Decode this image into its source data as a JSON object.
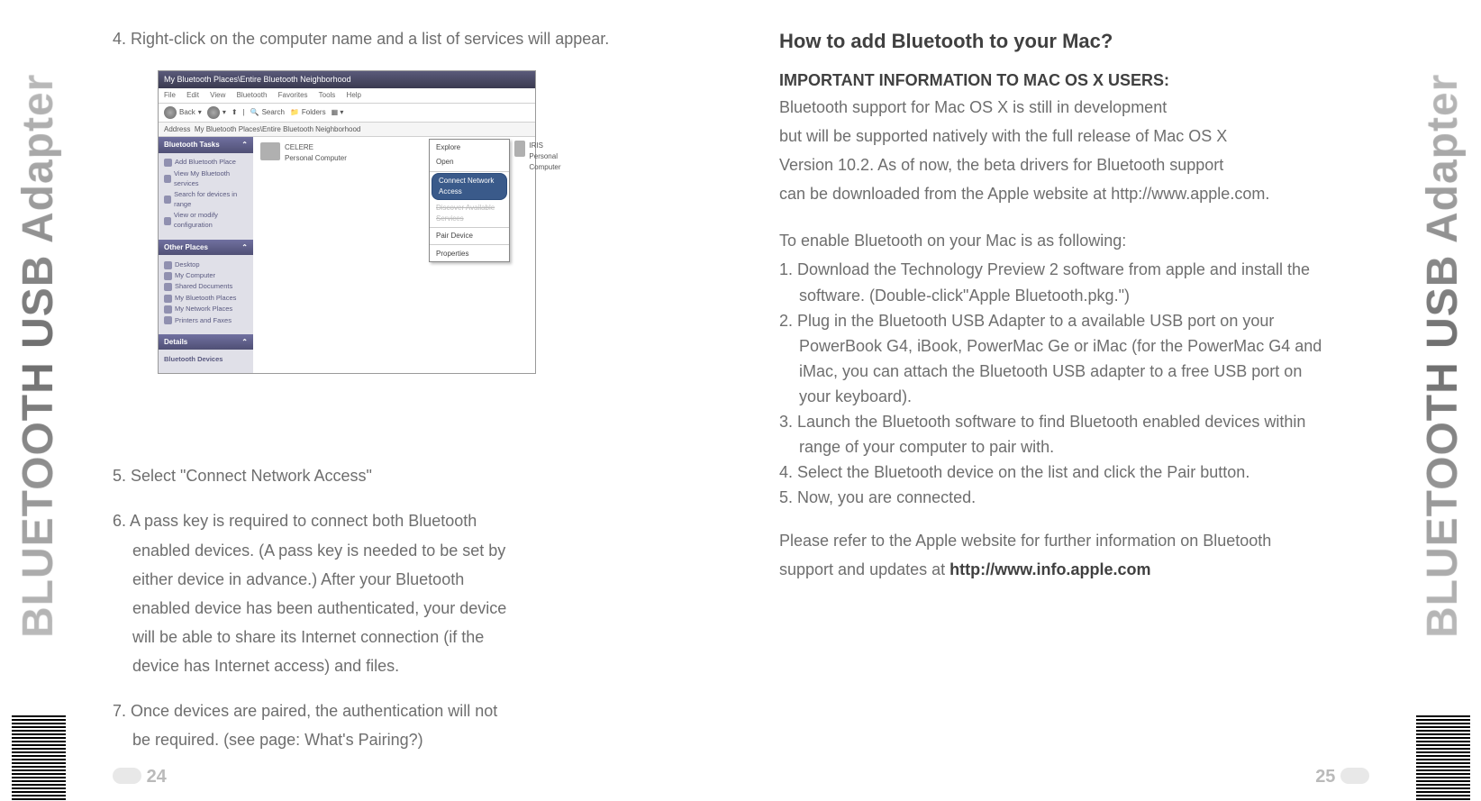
{
  "side_label": "BLUETOOTH USB Adapter",
  "left_page": {
    "step4": "4.  Right-click on the computer name and a list of services will appear.",
    "step5": "5. Select \"Connect Network Access\"",
    "step6_lead": "6. A pass key is required to connect both Bluetooth",
    "step6_l2": "enabled devices.  (A pass key is needed to be set by",
    "step6_l3": "either device in advance.) After your Bluetooth",
    "step6_l4": "enabled device has been authenticated, your device",
    "step6_l5": "will be able to share its Internet connection (if the",
    "step6_l6": "device has Internet access) and files.",
    "step7_lead": "7.  Once devices are paired, the authentication will not",
    "step7_l2": "be required. (see page: What's Pairing?)",
    "page_number": "24"
  },
  "right_page": {
    "heading": "How to add Bluetooth to your Mac?",
    "important": "IMPORTANT INFORMATION TO MAC OS X USERS:",
    "p1_l1": "Bluetooth support for Mac OS X is still in development",
    "p1_l2": "but will be supported natively with the full release of Mac OS X",
    "p1_l3": "Version 10.2.  As of now, the beta drivers for Bluetooth support",
    "p1_l4": "can be downloaded from the Apple website at http://www.apple.com.",
    "p2": "To enable Bluetooth on your Mac is as following:",
    "li1_l1": "1. Download the Technology Preview 2 software from apple and install the",
    "li1_l2": "software. (Double-click\"Apple Bluetooth.pkg.\")",
    "li2_l1": "2. Plug in the Bluetooth USB Adapter to a available USB port on your",
    "li2_l2": "PowerBook G4, iBook, PowerMac Ge or iMac (for the PowerMac G4 and",
    "li2_l3": "iMac, you can attach the Bluetooth USB adapter to a free USB port on",
    "li2_l4": "your keyboard).",
    "li3_l1": "3. Launch the Bluetooth software to find Bluetooth enabled devices within",
    "li3_l2": "range of your computer to pair with.",
    "li4": "4. Select the Bluetooth device on the list and click the Pair button.",
    "li5": "5. Now, you are connected.",
    "p3_l1": "Please refer to the Apple website for further information on Bluetooth",
    "p3_l2_a": "support and updates at ",
    "p3_l2_b": "http://www.info.apple.com",
    "page_number": "25"
  },
  "xp": {
    "title": "My Bluetooth Places\\Entire Bluetooth Neighborhood",
    "menu": {
      "file": "File",
      "edit": "Edit",
      "view": "View",
      "bluetooth": "Bluetooth",
      "favorites": "Favorites",
      "tools": "Tools",
      "help": "Help"
    },
    "toolbar": {
      "back": "Back",
      "search": "Search",
      "folders": "Folders"
    },
    "address_lbl": "Address",
    "address_val": "My Bluetooth Places\\Entire Bluetooth Neighborhood",
    "panel_tasks": "Bluetooth Tasks",
    "tasks": {
      "add": "Add Bluetooth Place",
      "view": "View My Bluetooth services",
      "search": "Search for devices in range",
      "config": "View or modify configuration"
    },
    "panel_other": "Other Places",
    "other": {
      "desktop": "Desktop",
      "mycomp": "My Computer",
      "shared": "Shared Documents",
      "mybt": "My Bluetooth Places",
      "mynet": "My Network Places",
      "printers": "Printers and Faxes"
    },
    "panel_details": "Details",
    "details_val": "Bluetooth Devices",
    "device1_name": "CELERE",
    "device1_type": "Personal Computer",
    "device2_name": "IRIS",
    "device2_type": "Personal Computer",
    "ctx": {
      "explore": "Explore",
      "open": "Open",
      "connect": "Connect Network Access",
      "discover": "Discover Available Services",
      "pair": "Pair Device",
      "properties": "Properties"
    }
  }
}
